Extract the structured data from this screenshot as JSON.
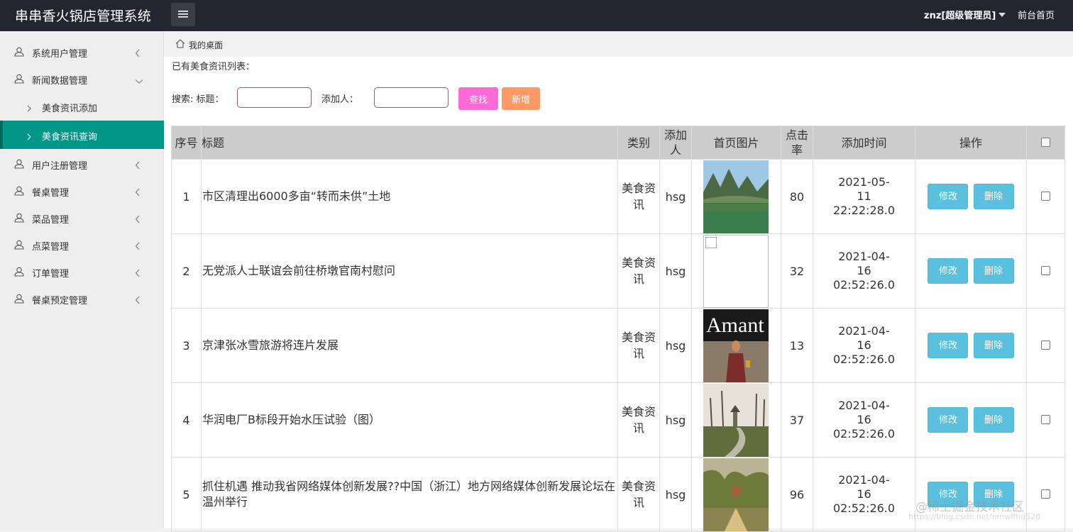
{
  "header": {
    "brand": "串串香火锅店管理系统",
    "user": "znz[超级管理员]",
    "front_link": "前台首页"
  },
  "sidebar": {
    "items": [
      {
        "label": "系统用户管理",
        "expanded": false
      },
      {
        "label": "新闻数据管理",
        "expanded": true,
        "children": [
          {
            "label": "美食资讯添加",
            "active": false
          },
          {
            "label": "美食资讯查询",
            "active": true
          }
        ]
      },
      {
        "label": "用户注册管理",
        "expanded": false
      },
      {
        "label": "餐桌管理",
        "expanded": false
      },
      {
        "label": "菜品管理",
        "expanded": false
      },
      {
        "label": "点菜管理",
        "expanded": false
      },
      {
        "label": "订单管理",
        "expanded": false
      },
      {
        "label": "餐桌预定管理",
        "expanded": false
      }
    ]
  },
  "breadcrumb": "我的桌面",
  "main": {
    "list_title": "已有美食资讯列表：",
    "search_label": "搜索: 标题：",
    "adder_label": "添加人：",
    "title_input": {
      "value": "",
      "placeholder": ""
    },
    "adder_input": {
      "value": "",
      "placeholder": ""
    },
    "search_button": "查找",
    "add_button": "新增"
  },
  "table": {
    "columns": [
      "序号",
      "标题",
      "类别",
      "添加人",
      "首页图片",
      "点击率",
      "添加时间",
      "操作"
    ],
    "edit_label": "修改",
    "delete_label": "删除",
    "rows": [
      {
        "no": "1",
        "title": "市区清理出6000多亩“转而未供”土地",
        "category": "美食资讯",
        "adder": "hsg",
        "image": "landscape-lake",
        "clicks": "80",
        "time": "2021-05-11 22:22:28.0"
      },
      {
        "no": "2",
        "title": "无党派人士联谊会前往桥墩官南村慰问",
        "category": "美食资讯",
        "adder": "hsg",
        "image": "broken-image",
        "clicks": "32",
        "time": "2021-04-16 02:52:26.0"
      },
      {
        "no": "3",
        "title": "京津张冰雪旅游将连片发展",
        "category": "美食资讯",
        "adder": "hsg",
        "image": "amant-portrait",
        "clicks": "13",
        "time": "2021-04-16 02:52:26.0"
      },
      {
        "no": "4",
        "title": "华润电厂B标段开始水压试验（图）",
        "category": "美食资讯",
        "adder": "hsg",
        "image": "park-pavilion",
        "clicks": "37",
        "time": "2021-04-16 02:52:26.0"
      },
      {
        "no": "5",
        "title": "抓住机遇 推动我省网络媒体创新发展??中国（浙江）地方网络媒体创新发展论坛在温州举行",
        "category": "美食资讯",
        "adder": "hsg",
        "image": "forest-painting",
        "clicks": "96",
        "time": "2021-04-16 02:52:26.0"
      }
    ]
  },
  "watermark": "@稀土掘金技术社区",
  "watermark_url": "https://blog.csdn.net/nmwlfhd528",
  "thumb_text": "Amant",
  "colors": {
    "header": "#23262e",
    "active_nav": "#009688",
    "search_btn": "#ff6bd6",
    "add_btn": "#ff9966",
    "action_btn": "#5bc0de"
  }
}
